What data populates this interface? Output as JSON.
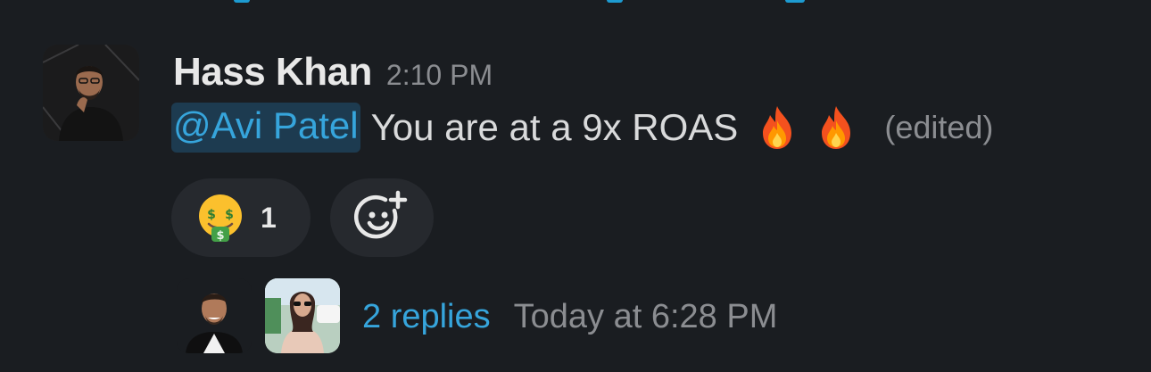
{
  "message": {
    "sender": "Hass Khan",
    "timestamp": "2:10 PM",
    "mention": "@Avi Patel",
    "text": "You are at a 9x ROAS",
    "emojis": [
      "fire",
      "fire"
    ],
    "edited_label": "(edited)"
  },
  "reactions": [
    {
      "emoji": "money-mouth-face",
      "count": "1"
    }
  ],
  "add_reaction_icon": "add-reaction-icon",
  "thread": {
    "reply_count_label": "2 replies",
    "last_reply": "Today at 6:28 PM"
  },
  "colors": {
    "background": "#1a1d21",
    "link": "#36a5dc",
    "mention_bg": "#1d3b50",
    "pill_bg": "#26292e",
    "muted": "#8b8d91"
  }
}
